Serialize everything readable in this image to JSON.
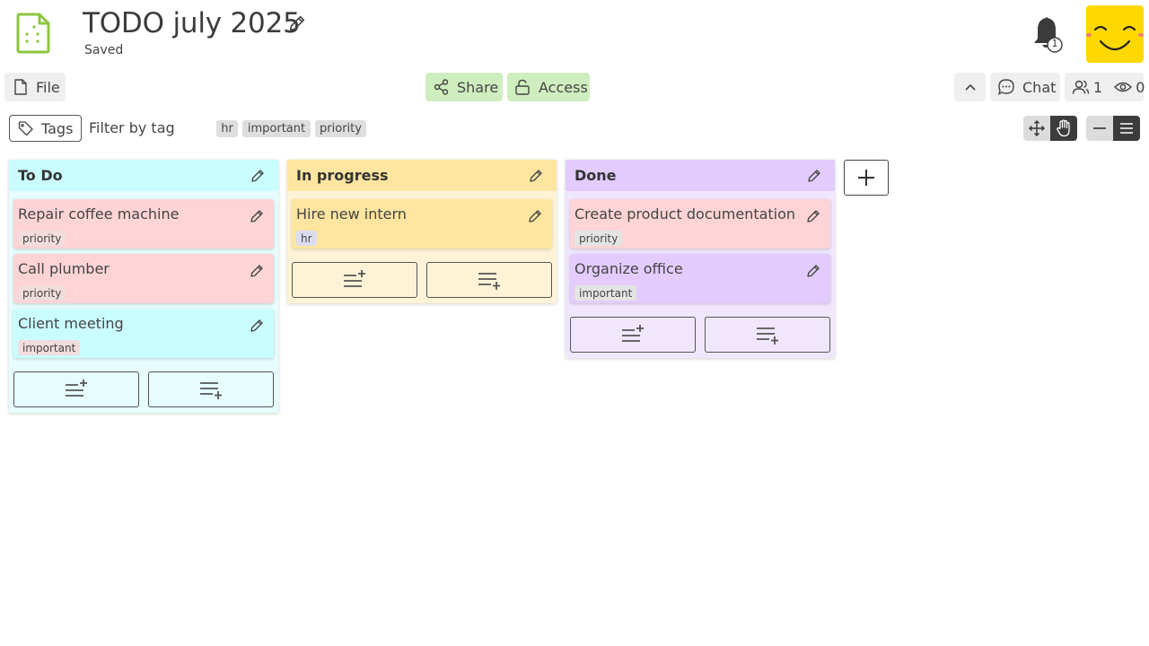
{
  "header": {
    "title": "TODO july 2025",
    "status": "Saved",
    "notification_count": "1"
  },
  "toolbar": {
    "file_label": "File",
    "share_label": "Share",
    "access_label": "Access",
    "chat_label": "Chat",
    "users_count": "1",
    "viewers_count": "0"
  },
  "filters": {
    "tags_label": "Tags",
    "filter_label": "Filter by tag",
    "tags": [
      "hr",
      "important",
      "priority"
    ]
  },
  "board": {
    "columns": [
      {
        "title": "To Do",
        "cards": [
          {
            "title": "Repair coffee machine",
            "tag": "priority"
          },
          {
            "title": "Call plumber",
            "tag": "priority"
          },
          {
            "title": "Client meeting",
            "tag": "important"
          }
        ]
      },
      {
        "title": "In progress",
        "cards": [
          {
            "title": "Hire new intern",
            "tag": "hr"
          }
        ]
      },
      {
        "title": "Done",
        "cards": [
          {
            "title": "Create product documentation",
            "tag": "priority"
          },
          {
            "title": "Organize office",
            "tag": "important"
          }
        ]
      }
    ]
  },
  "colors": {
    "accent_green": "#cfeebf",
    "todo": "#cafdff",
    "in_progress": "#ffe59f",
    "done": "#e3ccfd",
    "priority_card": "#ffd4d6",
    "avatar": "#ffd800"
  }
}
